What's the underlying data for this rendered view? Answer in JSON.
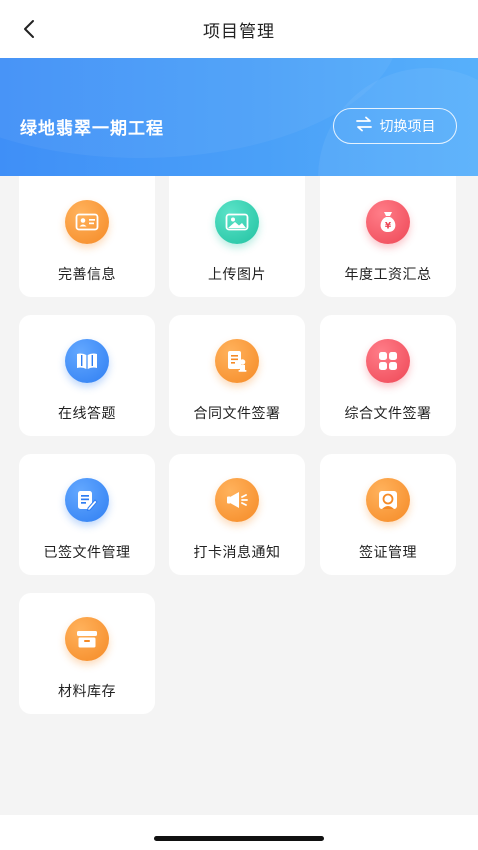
{
  "header": {
    "title": "项目管理"
  },
  "banner": {
    "project_name": "绿地翡翠一期工程",
    "switch_label": "切换项目"
  },
  "menu": [
    {
      "label": "完善信息",
      "icon": "id-card-icon",
      "color": "#f58a26"
    },
    {
      "label": "上传图片",
      "icon": "image-icon",
      "color": "#21c2a1"
    },
    {
      "label": "年度工资汇总",
      "icon": "money-bag-icon",
      "color": "#ee4756"
    },
    {
      "label": "在线答题",
      "icon": "book-icon",
      "color": "#2f7ef2"
    },
    {
      "label": "合同文件签署",
      "icon": "contract-sign-icon",
      "color": "#f58a26"
    },
    {
      "label": "综合文件签署",
      "icon": "grid-apps-icon",
      "color": "#ee4756"
    },
    {
      "label": "已签文件管理",
      "icon": "edit-document-icon",
      "color": "#2f7ef2"
    },
    {
      "label": "打卡消息通知",
      "icon": "megaphone-icon",
      "color": "#f58a26"
    },
    {
      "label": "签证管理",
      "icon": "certificate-icon",
      "color": "#f58a26"
    },
    {
      "label": "材料库存",
      "icon": "inventory-box-icon",
      "color": "#f58a26"
    }
  ]
}
